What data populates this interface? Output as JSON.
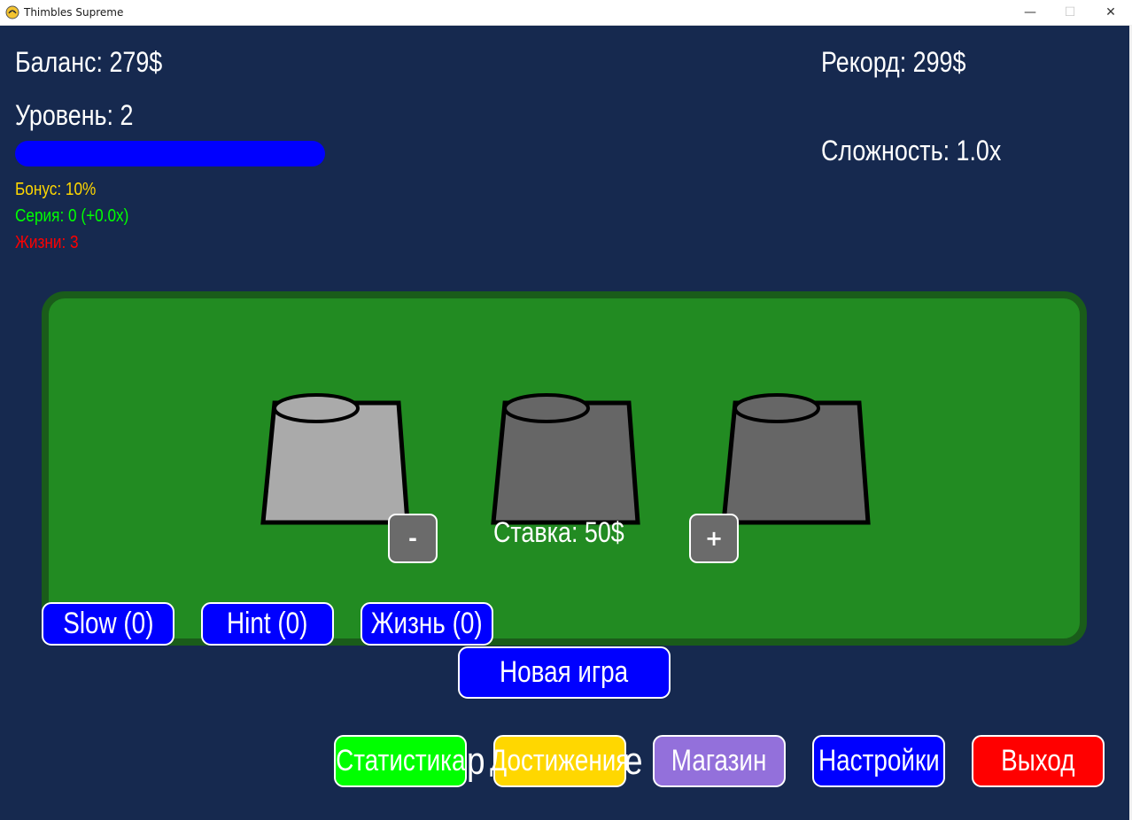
{
  "window": {
    "title": "Thimbles Supreme",
    "minimize_glyph": "—",
    "maximize_glyph": "☐",
    "close_glyph": "✕"
  },
  "hud": {
    "balance": "Баланс: 279$",
    "record": "Рекорд: 299$",
    "level": "Уровень: 2",
    "difficulty": "Сложность: 1.0x",
    "bonus": "Бонус: 10%",
    "streak": "Серия: 0 (+0.0x)",
    "lives": "Жизни: 3",
    "xp_progress": 1.0
  },
  "bet": {
    "minus_label": "-",
    "plus_label": "+",
    "text": "Ставка: 50$"
  },
  "cups": [
    {
      "state": "selected",
      "color": "#aaaaaa"
    },
    {
      "state": "normal",
      "color": "#666666"
    },
    {
      "state": "normal",
      "color": "#666666"
    }
  ],
  "powerups": {
    "slow": "Slow (0)",
    "hint": "Hint (0)",
    "life": "Жизнь (0)"
  },
  "new_game": "Новая игра",
  "menu": {
    "stats": "Статистика",
    "achievements": "Достижения",
    "shop": "Магазин",
    "settings": "Настройки",
    "exit": "Выход",
    "stats_overflow": "р",
    "achievements_overflow": "е"
  },
  "colors": {
    "background": "#16294f",
    "table": "#228b22",
    "table_border": "#1a5c1a",
    "bonus": "#ffd700",
    "streak": "#00ff00",
    "lives": "#ff0000",
    "button_blue": "#0000ff",
    "stats_green": "#00ff00",
    "achievements_yellow": "#ffd700",
    "shop_purple": "#9370db",
    "exit_red": "#ff0000"
  }
}
